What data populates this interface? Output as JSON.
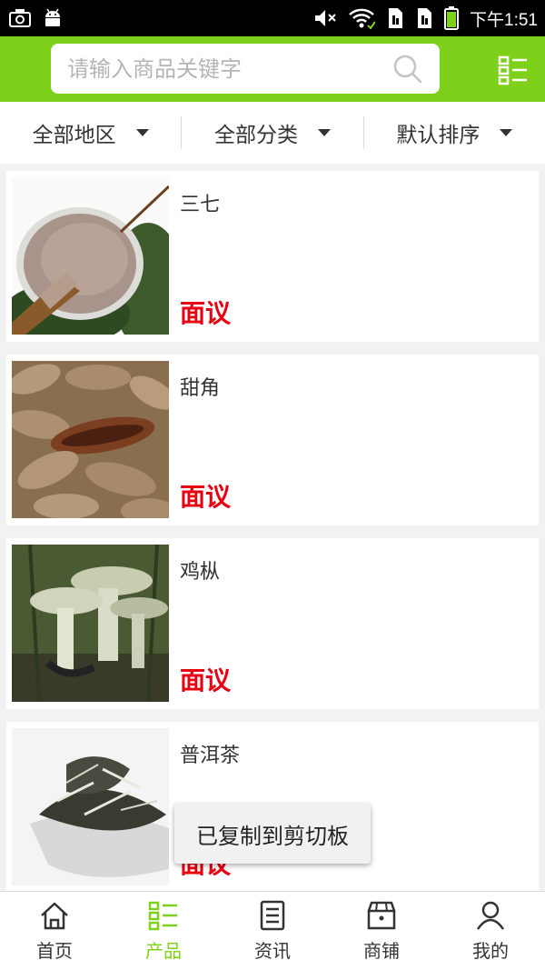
{
  "status_bar": {
    "time": "下午1:51",
    "icons": [
      "camera-icon",
      "android-icon",
      "mute-icon",
      "wifi-icon",
      "sim1-icon",
      "sim2-icon",
      "battery-icon"
    ]
  },
  "colors": {
    "accent": "#7fd01a",
    "price": "#e60012",
    "background": "#f2f2f2"
  },
  "search": {
    "placeholder": "请输入商品关键字",
    "value": ""
  },
  "filters": [
    {
      "label": "全部地区"
    },
    {
      "label": "全部分类"
    },
    {
      "label": "默认排序"
    }
  ],
  "products": [
    {
      "name": "三七",
      "price": "面议",
      "image": "powder-on-wooden-spoon"
    },
    {
      "name": "甜角",
      "price": "面议",
      "image": "tamarind-pods"
    },
    {
      "name": "鸡枞",
      "price": "面议",
      "image": "termite-mushrooms"
    },
    {
      "name": "普洱茶",
      "price": "面议",
      "image": "tea-leaves-in-bowl"
    }
  ],
  "toast": {
    "text": "已复制到剪切板"
  },
  "tabs": [
    {
      "label": "首页",
      "icon": "home-icon",
      "active": false
    },
    {
      "label": "产品",
      "icon": "product-list-icon",
      "active": true
    },
    {
      "label": "资讯",
      "icon": "news-icon",
      "active": false
    },
    {
      "label": "商铺",
      "icon": "shop-icon",
      "active": false
    },
    {
      "label": "我的",
      "icon": "user-icon",
      "active": false
    }
  ]
}
